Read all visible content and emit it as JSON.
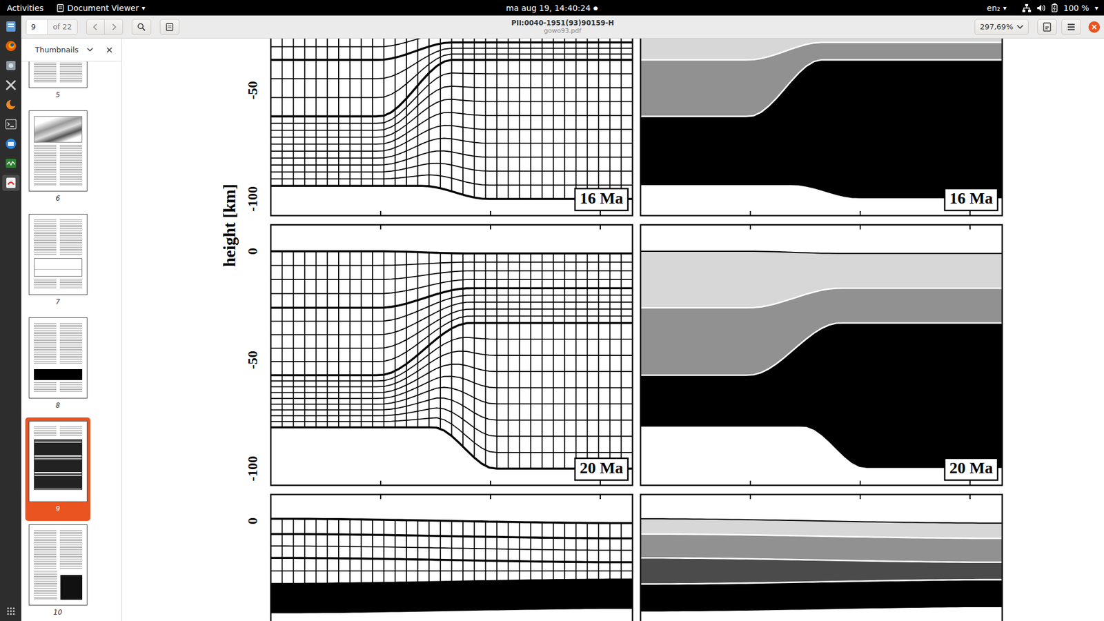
{
  "topbar": {
    "activities": "Activities",
    "app_menu": "Document Viewer",
    "app_menu_arrow": "▾",
    "clock": "ma aug 19, 14:40:24",
    "clock_dot": "●",
    "input_source": "en₂",
    "input_arrow": "▾",
    "battery": "100 %",
    "battery_arrow": "▾"
  },
  "dock": [
    {
      "kind": "files",
      "selected": false
    },
    {
      "kind": "firefox",
      "selected": false
    },
    {
      "kind": "disk",
      "selected": false
    },
    {
      "kind": "tools",
      "selected": false
    },
    {
      "kind": "redshift",
      "selected": false
    },
    {
      "kind": "terminal",
      "selected": false
    },
    {
      "kind": "thunderbird",
      "selected": false
    },
    {
      "kind": "monitor",
      "selected": false
    },
    {
      "kind": "viewer",
      "selected": true
    }
  ],
  "toolbar": {
    "page": "9",
    "page_count": "of 22",
    "title": "PII:0040-1951(93)90159-H",
    "subtitle": "gowo93.pdf",
    "zoom": "297,69%"
  },
  "sidebar": {
    "title": "Thumbnails",
    "close": "×",
    "thumbnails": [
      {
        "page": "5",
        "kind": "text",
        "selected": false
      },
      {
        "page": "6",
        "kind": "figure-top",
        "selected": false
      },
      {
        "page": "7",
        "kind": "figure-bottom",
        "selected": false
      },
      {
        "page": "8",
        "kind": "figure-block",
        "selected": false
      },
      {
        "page": "9",
        "kind": "figure-stack",
        "selected": true
      },
      {
        "page": "10",
        "kind": "figure-side",
        "selected": false
      }
    ]
  },
  "figure": {
    "y_label": "height [km]",
    "rows": [
      {
        "ticks": [
          "-50",
          "-100"
        ],
        "panels": [
          {
            "kind": "mesh",
            "label": "16 Ma"
          },
          {
            "kind": "shade",
            "label": "16 Ma"
          }
        ]
      },
      {
        "ticks": [
          "0",
          "-50",
          "-100"
        ],
        "panels": [
          {
            "kind": "mesh",
            "label": "20 Ma"
          },
          {
            "kind": "shade",
            "label": "20 Ma"
          }
        ]
      },
      {
        "ticks": [
          "0"
        ],
        "panels": [
          {
            "kind": "mesh"
          },
          {
            "kind": "shade"
          }
        ]
      }
    ]
  }
}
